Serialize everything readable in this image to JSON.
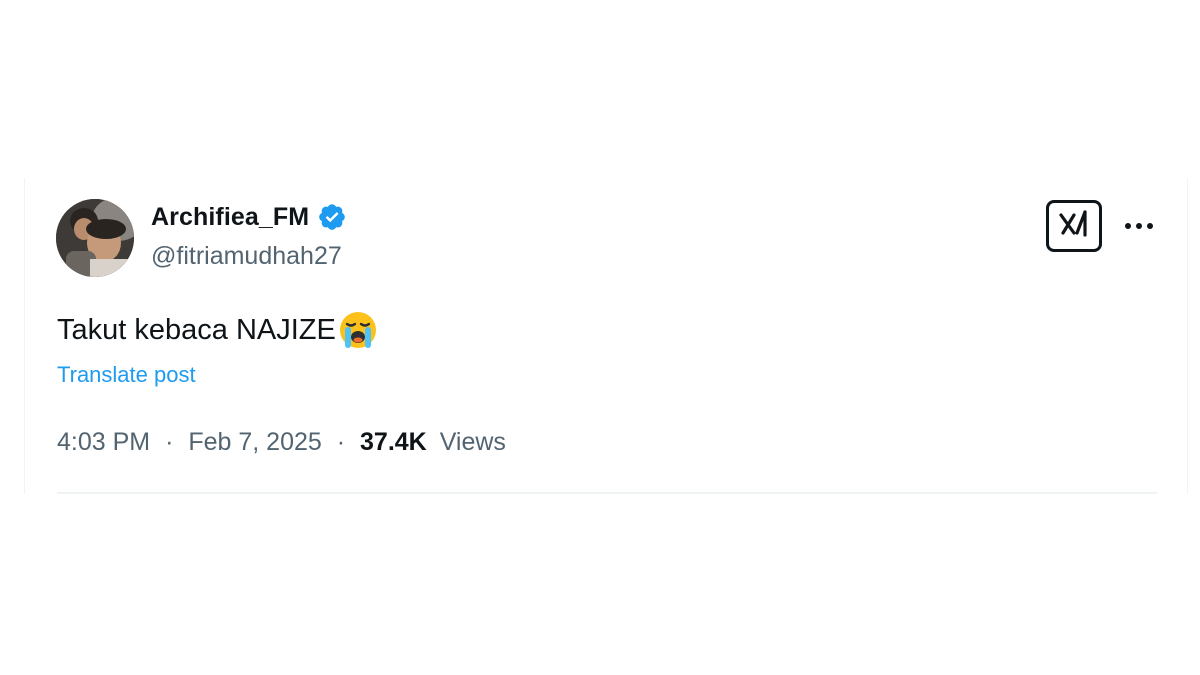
{
  "tweet": {
    "author": {
      "display_name": "Archifiea_FM",
      "handle": "@fitriamudhah27",
      "verified": true
    },
    "text": "Takut kebaca NAJIZE",
    "emoji": "loudly-crying-face-emoji",
    "translate_label": "Translate post",
    "time": "4:03 PM",
    "separator": "·",
    "date": "Feb 7, 2025",
    "views_count": "37.4K",
    "views_label": "Views"
  },
  "icons": {
    "verified": "verified-badge-icon",
    "grok": "grok-icon",
    "more": "more-options-icon"
  },
  "colors": {
    "text_primary": "#0f1419",
    "text_secondary": "#536471",
    "link": "#1d9bf0",
    "verified_badge": "#1d9bf0"
  }
}
